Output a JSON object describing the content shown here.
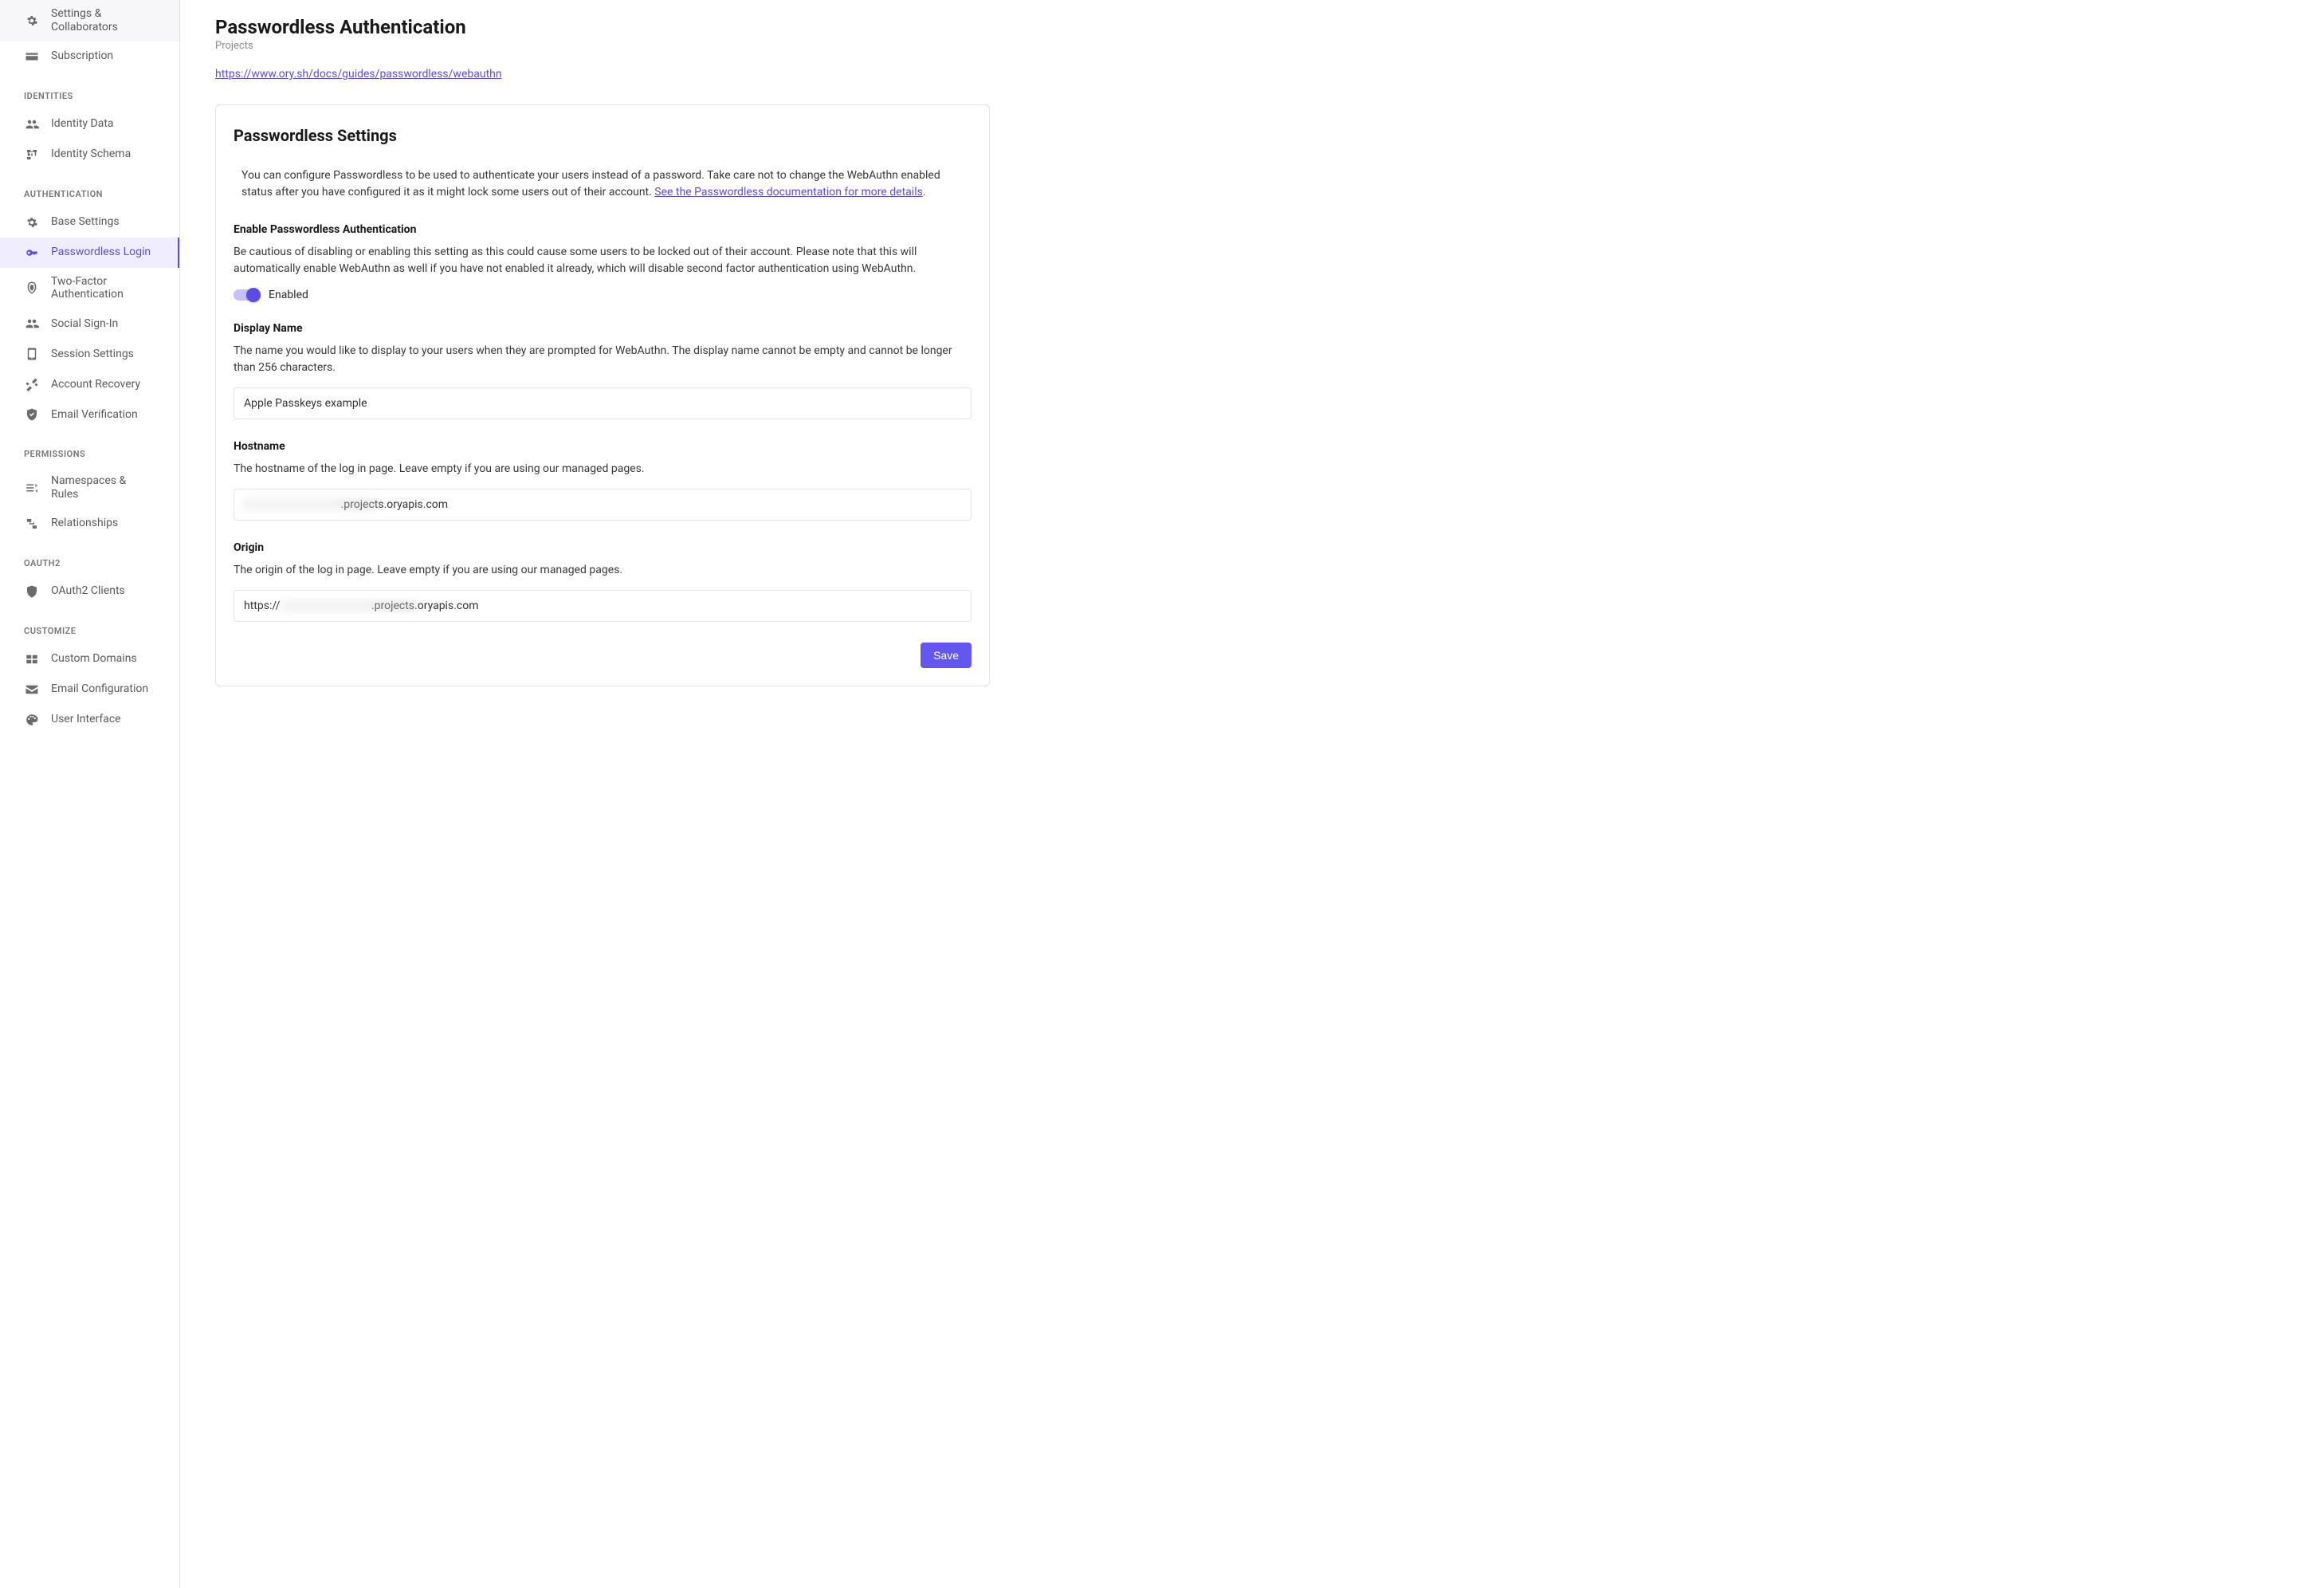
{
  "sidebar": {
    "top_items": [
      {
        "id": "settings-collaborators",
        "label": "Settings & Collaborators",
        "icon": "gear"
      },
      {
        "id": "subscription",
        "label": "Subscription",
        "icon": "card"
      }
    ],
    "sections": [
      {
        "heading": "IDENTITIES",
        "items": [
          {
            "id": "identity-data",
            "label": "Identity Data",
            "icon": "people"
          },
          {
            "id": "identity-schema",
            "label": "Identity Schema",
            "icon": "schema"
          }
        ]
      },
      {
        "heading": "AUTHENTICATION",
        "items": [
          {
            "id": "base-settings",
            "label": "Base Settings",
            "icon": "gear"
          },
          {
            "id": "passwordless",
            "label": "Passwordless Login",
            "icon": "key",
            "active": true
          },
          {
            "id": "two-factor",
            "label": "Two-Factor Authentication",
            "icon": "fingerprint"
          },
          {
            "id": "social-sign-in",
            "label": "Social Sign-In",
            "icon": "people"
          },
          {
            "id": "session-settings",
            "label": "Session Settings",
            "icon": "phone"
          },
          {
            "id": "account-recovery",
            "label": "Account Recovery",
            "icon": "tools"
          },
          {
            "id": "email-verification",
            "label": "Email Verification",
            "icon": "shield-check"
          }
        ]
      },
      {
        "heading": "PERMISSIONS",
        "items": [
          {
            "id": "namespaces-rules",
            "label": "Namespaces & Rules",
            "icon": "rules"
          },
          {
            "id": "relationships",
            "label": "Relationships",
            "icon": "relationship"
          }
        ]
      },
      {
        "heading": "OAUTH2",
        "items": [
          {
            "id": "oauth2-clients",
            "label": "OAuth2 Clients",
            "icon": "shield"
          }
        ]
      },
      {
        "heading": "CUSTOMIZE",
        "items": [
          {
            "id": "custom-domains",
            "label": "Custom Domains",
            "icon": "domains"
          },
          {
            "id": "email-configuration",
            "label": "Email Configuration",
            "icon": "mail"
          },
          {
            "id": "user-interface",
            "label": "User Interface",
            "icon": "palette"
          }
        ]
      }
    ]
  },
  "header": {
    "title": "Passwordless Authentication",
    "breadcrumb": "Projects",
    "doc_link_text": "https://www.ory.sh/docs/guides/passwordless/webauthn"
  },
  "card": {
    "title": "Passwordless Settings",
    "lead_text": "You can configure Passwordless to be used to authenticate your users instead of a password. Take care not to change the WebAuthn enabled status after you have configured it as it might lock some users out of their account. ",
    "lead_link_text": "See the Passwordless documentation for more details",
    "lead_suffix": ".",
    "enable": {
      "title": "Enable Passwordless Authentication",
      "desc": "Be cautious of disabling or enabling this setting as this could cause some users to be locked out of their account. Please note that this will automatically enable WebAuthn as well if you have not enabled it already, which will disable second factor authentication using WebAuthn.",
      "toggle_label": "Enabled",
      "toggle_on": true
    },
    "display_name": {
      "title": "Display Name",
      "desc": "The name you would like to display to your users when they are prompted for WebAuthn. The display name cannot be empty and cannot be longer than 256 characters.",
      "value": "Apple Passkeys example"
    },
    "hostname": {
      "title": "Hostname",
      "desc": "The hostname of the log in page. Leave empty if you are using our managed pages.",
      "value": "                                   .projects.oryapis.com"
    },
    "origin": {
      "title": "Origin",
      "desc": "The origin of the log in page. Leave empty if you are using our managed pages.",
      "value": "https://                                 .projects.oryapis.com"
    },
    "save_label": "Save"
  }
}
